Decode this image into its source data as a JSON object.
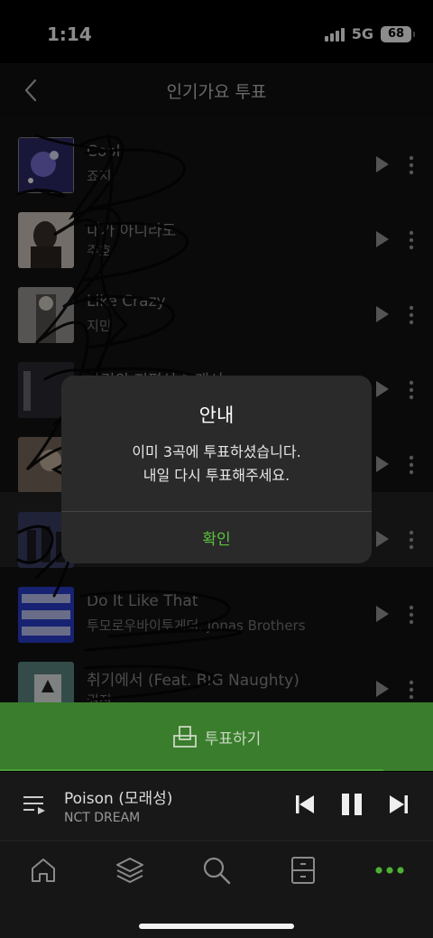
{
  "status_bar": {
    "time": "1:14",
    "network": "5G",
    "battery": "68"
  },
  "header": {
    "title": "인기가요 투표"
  },
  "songs": [
    {
      "title": "Cool",
      "artist": "죠지"
    },
    {
      "title": "내가 아니라도",
      "artist": "주호"
    },
    {
      "title": "Like Crazy",
      "artist": "지민"
    },
    {
      "title": "사건의 지평선 그래서",
      "artist": ""
    },
    {
      "title": "",
      "artist": ""
    },
    {
      "title": "",
      "artist": ""
    },
    {
      "title": "Do It Like That",
      "artist": "투모로우바이투게더, Jonas Brothers"
    },
    {
      "title": "취기에서 (Feat. BIG Naughty)",
      "artist": "권진"
    }
  ],
  "dialog": {
    "title": "안내",
    "message_line1": "이미 3곡에 투표하셨습니다.",
    "message_line2": "내일 다시 투표해주세요.",
    "confirm_label": "확인"
  },
  "vote_button": {
    "label": "투표하기"
  },
  "now_playing": {
    "title": "Poison (모래성)",
    "artist": "NCT DREAM",
    "progress_fraction": 0.885
  },
  "tabs": [
    {
      "icon": "home-icon"
    },
    {
      "icon": "layers-icon"
    },
    {
      "icon": "search-icon"
    },
    {
      "icon": "storage-icon"
    },
    {
      "icon": "more-dots-icon",
      "active": true
    }
  ],
  "colors": {
    "accent": "#5cc13e",
    "vote_bar": "#3a7d2c",
    "background": "#131313"
  }
}
